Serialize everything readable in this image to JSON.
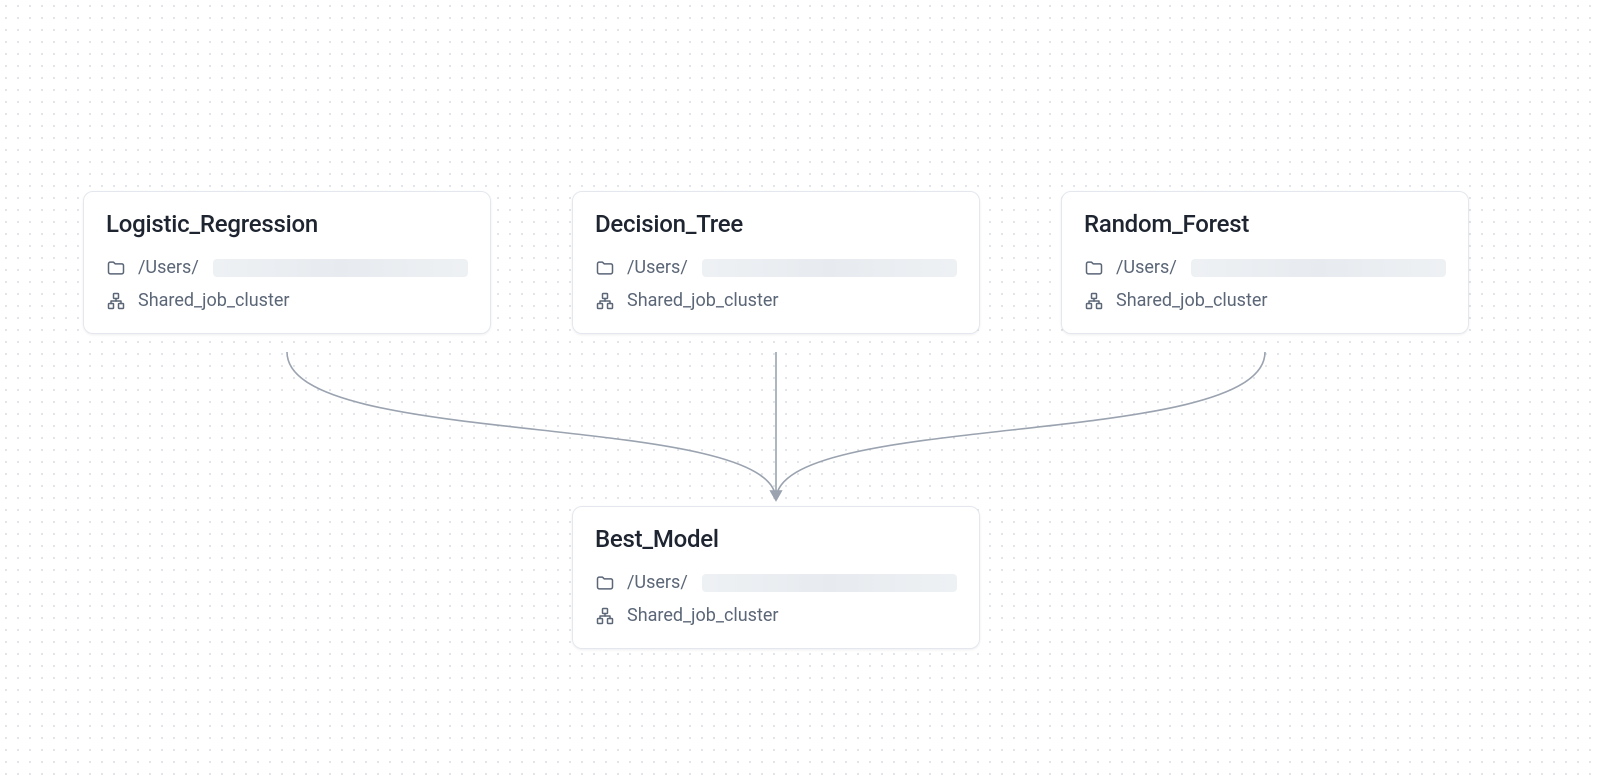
{
  "nodes": {
    "logistic_regression": {
      "title": "Logistic_Regression",
      "path_prefix": "/Users/",
      "cluster": "Shared_job_cluster"
    },
    "decision_tree": {
      "title": "Decision_Tree",
      "path_prefix": "/Users/",
      "cluster": "Shared_job_cluster"
    },
    "random_forest": {
      "title": "Random_Forest",
      "path_prefix": "/Users/",
      "cluster": "Shared_job_cluster"
    },
    "best_model": {
      "title": "Best_Model",
      "path_prefix": "/Users/",
      "cluster": "Shared_job_cluster"
    }
  },
  "edges": [
    {
      "from": "logistic_regression",
      "to": "best_model"
    },
    {
      "from": "decision_tree",
      "to": "best_model"
    },
    {
      "from": "random_forest",
      "to": "best_model"
    }
  ]
}
